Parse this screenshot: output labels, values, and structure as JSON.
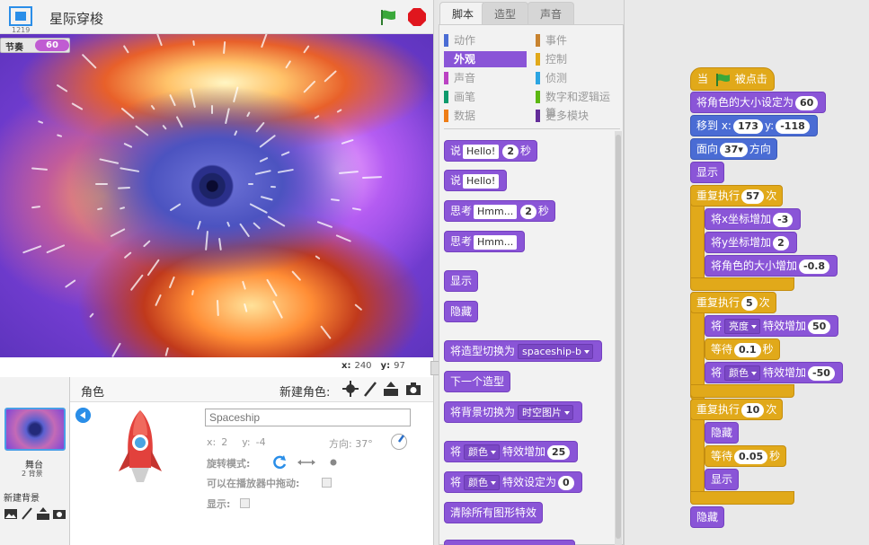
{
  "header": {
    "version": "1219",
    "title": "星际穿梭"
  },
  "stage": {
    "tempo_label": "节奏",
    "tempo_value": "60",
    "x_label": "x:",
    "x_value": "240",
    "y_label": "y:",
    "y_value": "97"
  },
  "sprite_pane": {
    "title": "角色",
    "new_sprite_label": "新建角色:",
    "stage_label": "舞台",
    "stage_count": "2 背景",
    "new_backdrop_label": "新建背景",
    "sprite_name_placeholder": "Spaceship",
    "x_label": "x:",
    "x_value": "2",
    "y_label": "y:",
    "y_value": "-4",
    "direction_label": "方向:",
    "direction_value": "37°",
    "rotation_label": "旋转模式:",
    "draggable_label": "可以在播放器中拖动:",
    "show_label": "显示:"
  },
  "tabs": [
    "脚本",
    "造型",
    "声音"
  ],
  "categories": [
    {
      "label": "动作",
      "color": "#4a6cd4"
    },
    {
      "label": "事件",
      "color": "#c88330"
    },
    {
      "label": "外观",
      "color": "#8a55d7"
    },
    {
      "label": "控制",
      "color": "#e1a91a"
    },
    {
      "label": "声音",
      "color": "#bb42c3"
    },
    {
      "label": "侦测",
      "color": "#2ca5e2"
    },
    {
      "label": "画笔",
      "color": "#0e9a6c"
    },
    {
      "label": "数字和逻辑运算",
      "color": "#5cb712"
    },
    {
      "label": "数据",
      "color": "#ee7d16"
    },
    {
      "label": "更多模块",
      "color": "#632d99"
    }
  ],
  "palette": {
    "say_secs": {
      "a": "说",
      "text": "Hello!",
      "secs": "2",
      "b": "秒"
    },
    "say": {
      "a": "说",
      "text": "Hello!"
    },
    "think_secs": {
      "a": "思考",
      "text": "Hmm...",
      "secs": "2",
      "b": "秒"
    },
    "think": {
      "a": "思考",
      "text": "Hmm..."
    },
    "show": "显示",
    "hide": "隐藏",
    "switch_costume": {
      "a": "将造型切换为",
      "value": "spaceship-b"
    },
    "next_costume": "下一个造型",
    "switch_backdrop": {
      "a": "将背景切换为",
      "value": "时空图片"
    },
    "change_effect": {
      "a": "将",
      "effect": "颜色",
      "b": "特效增加",
      "value": "25"
    },
    "set_effect": {
      "a": "将",
      "effect": "颜色",
      "b": "特效设定为",
      "value": "0"
    },
    "clear_effects": "清除所有图形特效"
  },
  "script": {
    "hat": {
      "a": "当",
      "b": "被点击"
    },
    "set_size": {
      "a": "将角色的大小设定为",
      "value": "60"
    },
    "goto": {
      "a": "移到 x:",
      "x": "173",
      "b": "y:",
      "y": "-118"
    },
    "point": {
      "a": "面向",
      "value": "37▾",
      "b": "方向"
    },
    "show1": "显示",
    "repeat1": {
      "a": "重复执行",
      "n": "57",
      "b": "次"
    },
    "change_x": {
      "a": "将x坐标增加",
      "value": "-3"
    },
    "change_y": {
      "a": "将y坐标增加",
      "value": "2"
    },
    "change_size": {
      "a": "将角色的大小增加",
      "value": "-0.8"
    },
    "repeat2": {
      "a": "重复执行",
      "n": "5",
      "b": "次"
    },
    "eff1": {
      "a": "将",
      "effect": "亮度",
      "b": "特效增加",
      "value": "50"
    },
    "wait1": {
      "a": "等待",
      "value": "0.1",
      "b": "秒"
    },
    "eff2": {
      "a": "将",
      "effect": "颜色",
      "b": "特效增加",
      "value": "-50"
    },
    "repeat3": {
      "a": "重复执行",
      "n": "10",
      "b": "次"
    },
    "hide1": "隐藏",
    "wait2": {
      "a": "等待",
      "value": "0.05",
      "b": "秒"
    },
    "show2": "显示",
    "hide2": "隐藏"
  }
}
